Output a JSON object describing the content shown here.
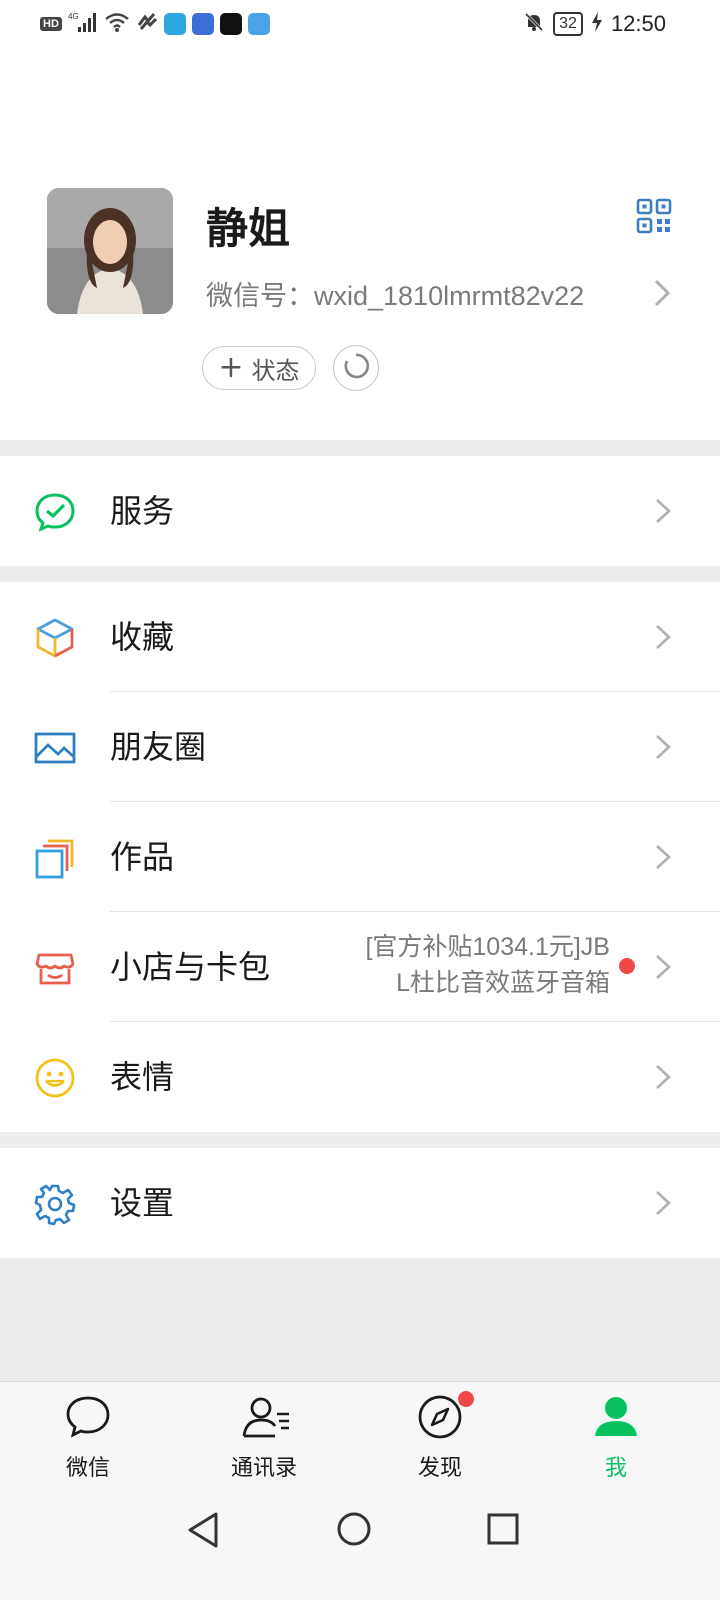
{
  "status_bar": {
    "left_badge": "HD",
    "network": "4G",
    "battery": "32",
    "time": "12:50"
  },
  "profile": {
    "name": "静姐",
    "wechat_id": "微信号：wxid_1810lmrmt82v22",
    "status_button_label": "状态"
  },
  "menu": {
    "services": {
      "label": "服务",
      "icon": "wechat-pay-check-icon"
    },
    "favorites": {
      "label": "收藏",
      "icon": "cube-icon"
    },
    "moments": {
      "label": "朋友圈",
      "icon": "image-icon"
    },
    "works": {
      "label": "作品",
      "icon": "stacked-cards-icon"
    },
    "shop": {
      "label": "小店与卡包",
      "icon": "shop-icon",
      "promo_line1": "[官方补贴1034.1元]JB",
      "promo_line2": "L杜比音效蓝牙音箱"
    },
    "stickers": {
      "label": "表情",
      "icon": "smiley-icon"
    },
    "settings": {
      "label": "设置",
      "icon": "gear-icon"
    }
  },
  "tabs": [
    {
      "label": "微信",
      "icon": "chat-bubble-icon"
    },
    {
      "label": "通讯录",
      "icon": "contacts-icon"
    },
    {
      "label": "发现",
      "icon": "compass-icon"
    },
    {
      "label": "我",
      "icon": "person-icon"
    }
  ],
  "colors": {
    "accent": "#07c160",
    "badge_red": "#f04848",
    "background": "#ededed"
  }
}
